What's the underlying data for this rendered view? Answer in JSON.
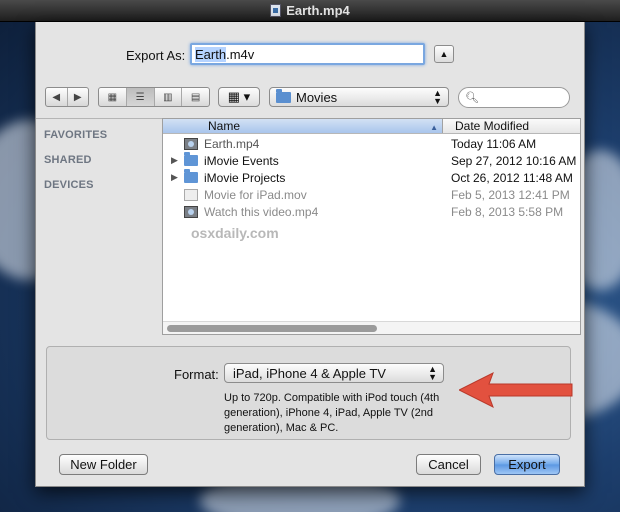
{
  "window": {
    "title": "Earth.mp4"
  },
  "export": {
    "label": "Export As:",
    "filename_selected": "Earth",
    "filename_rest": ".m4v"
  },
  "toolbar": {
    "location": "Movies",
    "search_placeholder": ""
  },
  "sidebar": {
    "sections": [
      {
        "label": "FAVORITES"
      },
      {
        "label": "SHARED"
      },
      {
        "label": "DEVICES"
      }
    ]
  },
  "browser": {
    "columns": {
      "name": "Name",
      "date": "Date Modified"
    },
    "rows": [
      {
        "name": "Earth.mp4",
        "date": "Today 11:06 AM"
      },
      {
        "name": "iMovie Events",
        "date": "Sep 27, 2012 10:16 AM"
      },
      {
        "name": "iMovie Projects",
        "date": "Oct 26, 2012 11:48 AM"
      },
      {
        "name": "Movie for iPad.mov",
        "date": "Feb 5, 2013 12:41 PM"
      },
      {
        "name": "Watch this video.mp4",
        "date": "Feb 8, 2013 5:58 PM"
      }
    ],
    "watermark": "osxdaily.com"
  },
  "format": {
    "label": "Format:",
    "selected": "iPad, iPhone 4 & Apple TV",
    "description": "Up to 720p. Compatible with iPod touch (4th generation), iPhone 4, iPad, Apple TV (2nd generation), Mac & PC."
  },
  "buttons": {
    "new_folder": "New Folder",
    "cancel": "Cancel",
    "export": "Export"
  },
  "colors": {
    "annotation_arrow": "#e2513f",
    "selection": "#b5d3ff"
  }
}
